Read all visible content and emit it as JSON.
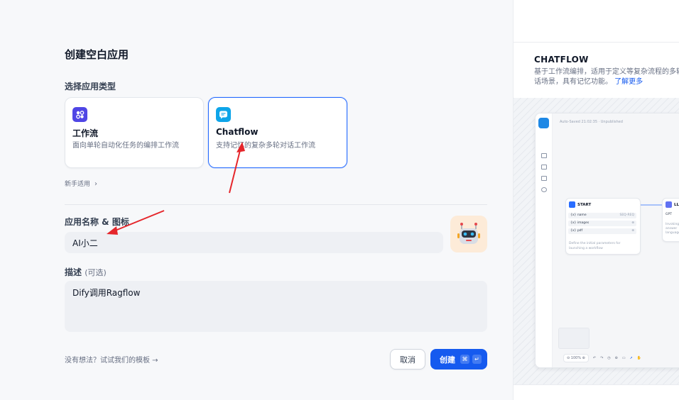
{
  "dialog": {
    "title": "创建空白应用",
    "type_section_label": "选择应用类型",
    "app_types": [
      {
        "name": "工作流",
        "desc": "面向单轮自动化任务的编排工作流",
        "icon": "workflow-icon",
        "selected": false,
        "color": "#4f46e5"
      },
      {
        "name": "Chatflow",
        "desc": "支持记忆的复杂多轮对话工作流",
        "icon": "chatflow-icon",
        "selected": true,
        "color": "#0ea5e9"
      }
    ],
    "newbie_label": "新手适用",
    "name_label": "应用名称 & 图标",
    "name_value": "AI小二",
    "avatar_icon": "robot-icon",
    "desc_label": "描述",
    "desc_optional": "(可选)",
    "desc_value": "Dify调用Ragflow",
    "template_hint": "没有想法？试试我们的模板 →",
    "cancel_label": "取消",
    "create_label": "创建",
    "create_shortcut_1": "⌘",
    "create_shortcut_2": "↵",
    "accent_color": "#155aef"
  },
  "preview": {
    "title": "CHATFLOW",
    "desc": "基于工作流编排，适用于定义等复杂流程的多轮对话场景，具有记忆功能。",
    "learn_more": "了解更多",
    "status": "Auto-Saved 21:02:35 · Unpublished",
    "start_node": {
      "title": "START",
      "vars": [
        {
          "name": "{x} name",
          "type": "SEQ-REQ"
        },
        {
          "name": "{x} images",
          "type": "⊕"
        },
        {
          "name": "{x} pdf",
          "type": "⊕"
        }
      ],
      "note": "Define the initial parameters for launching a workflow"
    },
    "llm_node": {
      "title": "LL",
      "tag": "GPT",
      "note": "Invoking answer language"
    },
    "zoom": "100%"
  }
}
